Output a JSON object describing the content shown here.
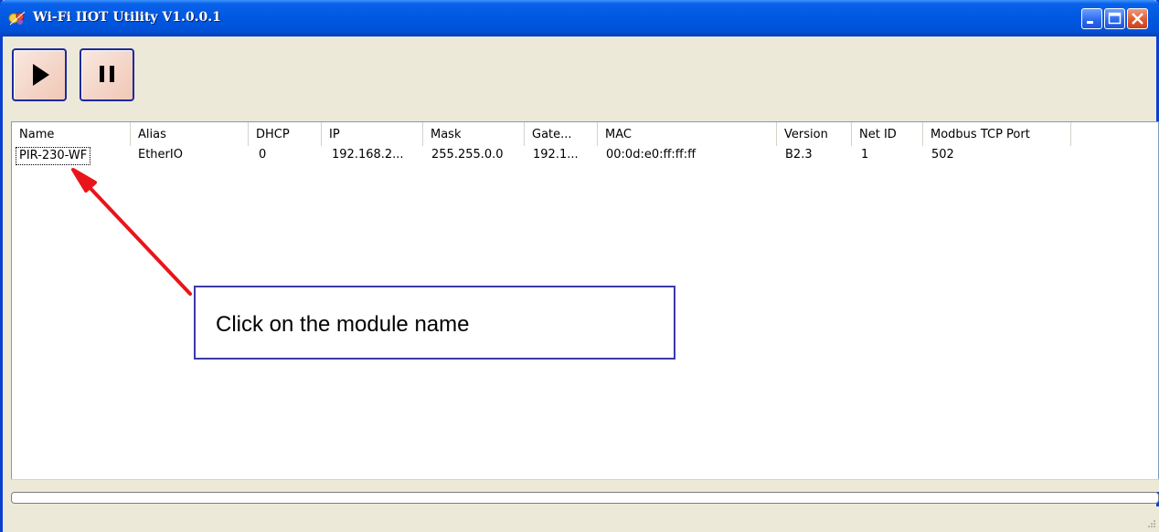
{
  "window": {
    "title": "Wi-Fi IIOT Utility V1.0.0.1"
  },
  "toolbar": {
    "buttons": [
      {
        "icon": "play-icon"
      },
      {
        "icon": "pause-icon"
      }
    ]
  },
  "device_list": {
    "columns": [
      "Name",
      "Alias",
      "DHCP",
      "IP",
      "Mask",
      "Gate...",
      "MAC",
      "Version",
      "Net ID",
      "Modbus TCP Port"
    ],
    "rows": [
      [
        "PIR-230-WF",
        "EtherIO",
        "0",
        "192.168.2...",
        "255.255.0.0",
        "192.1...",
        "00:0d:e0:ff:ff:ff",
        "B2.3",
        "1",
        "502"
      ]
    ]
  },
  "annotation": {
    "callout_text": "Click on the module name",
    "arrow_color": "#e8151b"
  },
  "colors": {
    "titlebar": "#0058e0",
    "window_face": "#ece9d8",
    "callout_border": "#3a3aa8"
  }
}
